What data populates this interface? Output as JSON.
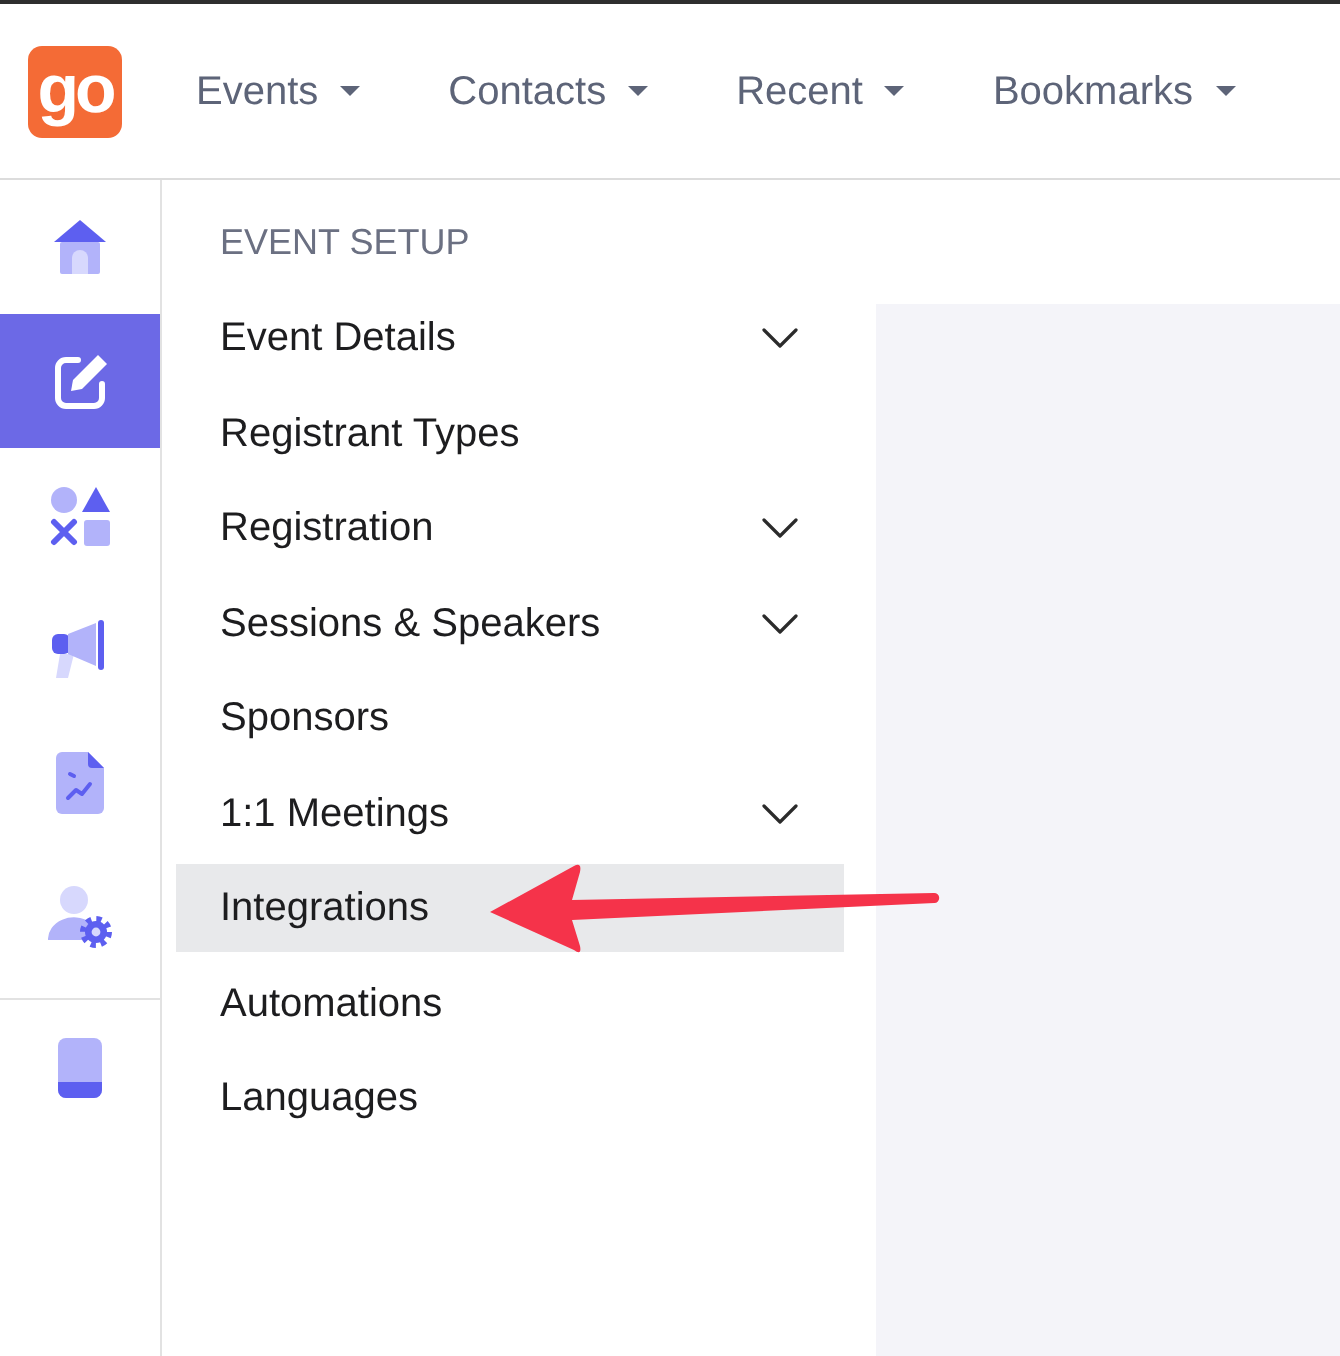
{
  "header": {
    "logo": "go",
    "menus": [
      {
        "label": "Events"
      },
      {
        "label": "Contacts"
      },
      {
        "label": "Recent"
      },
      {
        "label": "Bookmarks"
      }
    ]
  },
  "icon_rail": {
    "main": [
      {
        "selected": false
      },
      {
        "selected": true
      },
      {
        "selected": false
      },
      {
        "selected": false
      },
      {
        "selected": false
      },
      {
        "selected": false
      }
    ],
    "footer": [
      {
        "selected": false
      }
    ]
  },
  "submenu": {
    "heading": "EVENT SETUP",
    "items": [
      {
        "label": "Event Details",
        "expandable": true,
        "selected": false
      },
      {
        "label": "Registrant Types",
        "expandable": false,
        "selected": false
      },
      {
        "label": "Registration",
        "expandable": true,
        "selected": false
      },
      {
        "label": "Sessions & Speakers",
        "expandable": true,
        "selected": false
      },
      {
        "label": "Sponsors",
        "expandable": false,
        "selected": false
      },
      {
        "label": "1:1 Meetings",
        "expandable": true,
        "selected": false
      },
      {
        "label": "Integrations",
        "expandable": false,
        "selected": true
      },
      {
        "label": "Automations",
        "expandable": false,
        "selected": false
      },
      {
        "label": "Languages",
        "expandable": false,
        "selected": false
      }
    ]
  }
}
